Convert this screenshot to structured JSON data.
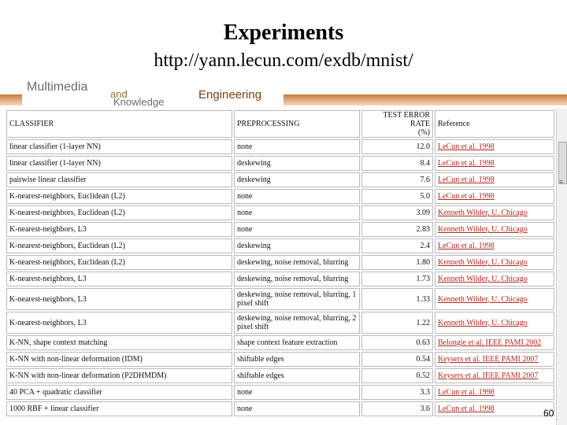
{
  "slide": {
    "title": "Experiments",
    "url": "http://yann.lecun.com/exdb/mnist/",
    "page_number": "60"
  },
  "logo": {
    "line1": "Multimedia",
    "line2": "and",
    "line3": "Knowledge",
    "line4": "Engineering"
  },
  "table": {
    "headers": {
      "classifier": "CLASSIFIER",
      "preprocessing": "PREPROCESSING",
      "error_line1": "TEST ERROR RATE",
      "error_line2": "(%)",
      "reference": "Reference"
    },
    "rows": [
      {
        "classifier": "linear classifier (1-layer NN)",
        "preprocessing": "none",
        "error": "12.0",
        "reference": "LeCun et al. 1998"
      },
      {
        "classifier": "linear classifier (1-layer NN)",
        "preprocessing": "deskewing",
        "error": "8.4",
        "reference": "LeCun et al. 1998"
      },
      {
        "classifier": "pairwise linear classifier",
        "preprocessing": "deskewing",
        "error": "7.6",
        "reference": "LeCun et al. 1998"
      },
      {
        "classifier": "K-nearest-neighbors, Euclidean (L2)",
        "preprocessing": "none",
        "error": "5.0",
        "reference": "LeCun et al. 1998"
      },
      {
        "classifier": "K-nearest-neighbors, Euclidean (L2)",
        "preprocessing": "none",
        "error": "3.09",
        "reference": "Kenneth Wilder, U. Chicago"
      },
      {
        "classifier": "K-nearest-neighbors, L3",
        "preprocessing": "none",
        "error": "2.83",
        "reference": "Kenneth Wilder, U. Chicago"
      },
      {
        "classifier": "K-nearest-neighbors, Euclidean (L2)",
        "preprocessing": "deskewing",
        "error": "2.4",
        "reference": "LeCun et al. 1998"
      },
      {
        "classifier": "K-nearest-neighbors, Euclidean (L2)",
        "preprocessing": "deskewing, noise removal, blurring",
        "error": "1.80",
        "reference": "Kenneth Wilder, U. Chicago"
      },
      {
        "classifier": "K-nearest-neighbors, L3",
        "preprocessing": "deskewing, noise removal, blurring",
        "error": "1.73",
        "reference": "Kenneth Wilder, U. Chicago"
      },
      {
        "classifier": "K-nearest-neighbors, L3",
        "preprocessing": "deskewing, noise removal, blurring, 1 pixel shift",
        "error": "1.33",
        "reference": "Kenneth Wilder, U. Chicago"
      },
      {
        "classifier": "K-nearest-neighbors, L3",
        "preprocessing": "deskewing, noise removal, blurring, 2 pixel shift",
        "error": "1.22",
        "reference": "Kenneth Wilder, U. Chicago"
      },
      {
        "classifier": "K-NN, shape context matching",
        "preprocessing": "shape context feature extraction",
        "error": "0.63",
        "reference": "Belongie et al. IEEE PAMI 2002"
      },
      {
        "classifier": "K-NN with non-linear deformation (IDM)",
        "preprocessing": "shiftable edges",
        "error": "0.54",
        "reference": "Keysers et al. IEEE PAMI 2007"
      },
      {
        "classifier": "K-NN with non-linear deformation (P2DHMDM)",
        "preprocessing": "shiftable edges",
        "error": "0.52",
        "reference": "Keysers et al. IEEE PAMI 2007"
      },
      {
        "classifier": "40 PCA + quadratic classifier",
        "preprocessing": "none",
        "error": "3.3",
        "reference": "LeCun et al. 1998"
      },
      {
        "classifier": "1000 RBF + linear classifier",
        "preprocessing": "none",
        "error": "3.6",
        "reference": "LeCun et al. 1998"
      }
    ]
  }
}
